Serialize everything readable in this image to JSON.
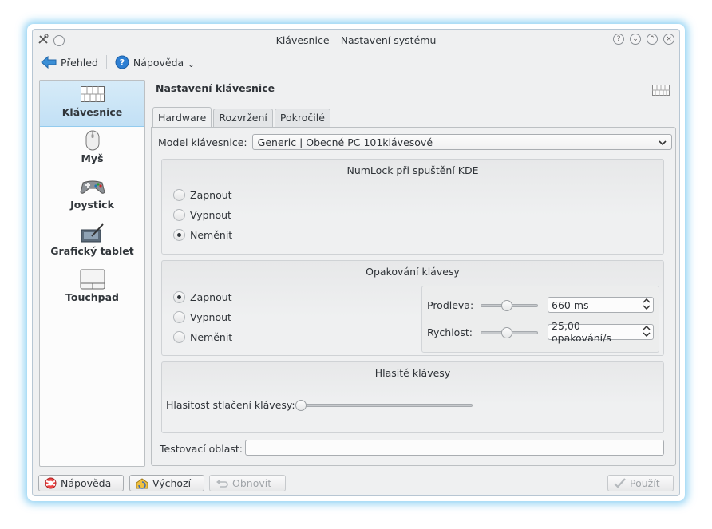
{
  "window": {
    "title": "Klávesnice – Nastavení systému",
    "title_buttons": [
      "?",
      "⌄",
      "⌃",
      "×"
    ]
  },
  "toolbar": {
    "overview_label": "Přehled",
    "help_label": "Nápověda"
  },
  "sidebar": {
    "items": [
      {
        "label": "Klávesnice",
        "icon": "keyboard-icon",
        "selected": true
      },
      {
        "label": "Myš",
        "icon": "mouse-icon",
        "selected": false
      },
      {
        "label": "Joystick",
        "icon": "gamepad-icon",
        "selected": false
      },
      {
        "label": "Grafický tablet",
        "icon": "tablet-icon",
        "selected": false
      },
      {
        "label": "Touchpad",
        "icon": "touchpad-icon",
        "selected": false
      }
    ]
  },
  "page": {
    "title": "Nastavení klávesnice",
    "tabs": [
      "Hardware",
      "Rozvržení",
      "Pokročilé"
    ],
    "active_tab": "Hardware"
  },
  "hardware": {
    "model_label": "Model klávesnice:",
    "model_value": "Generic | Obecné PC 101klávesové",
    "numlock": {
      "title": "NumLock při spuštění KDE",
      "options": [
        "Zapnout",
        "Vypnout",
        "Neměnit"
      ],
      "selected": "Neměnit"
    },
    "repeat": {
      "title": "Opakování klávesy",
      "options": [
        "Zapnout",
        "Vypnout",
        "Neměnit"
      ],
      "selected": "Zapnout",
      "delay_label": "Prodleva:",
      "delay_value": "660 ms",
      "delay_slider": 0.45,
      "rate_label": "Rychlost:",
      "rate_value": "25,00 opakování/s",
      "rate_slider": 0.45
    },
    "click": {
      "title": "Hlasité klávesy",
      "volume_label": "Hlasitost stlačení klávesy:",
      "volume_slider": 0.0
    },
    "test_label": "Testovací oblast:",
    "test_value": ""
  },
  "buttons": {
    "help": "Nápověda",
    "defaults": "Výchozí",
    "reset": "Obnovit",
    "apply": "Použít"
  },
  "colors": {
    "accent": "#3daee9",
    "selection": "#c2e0f5"
  }
}
